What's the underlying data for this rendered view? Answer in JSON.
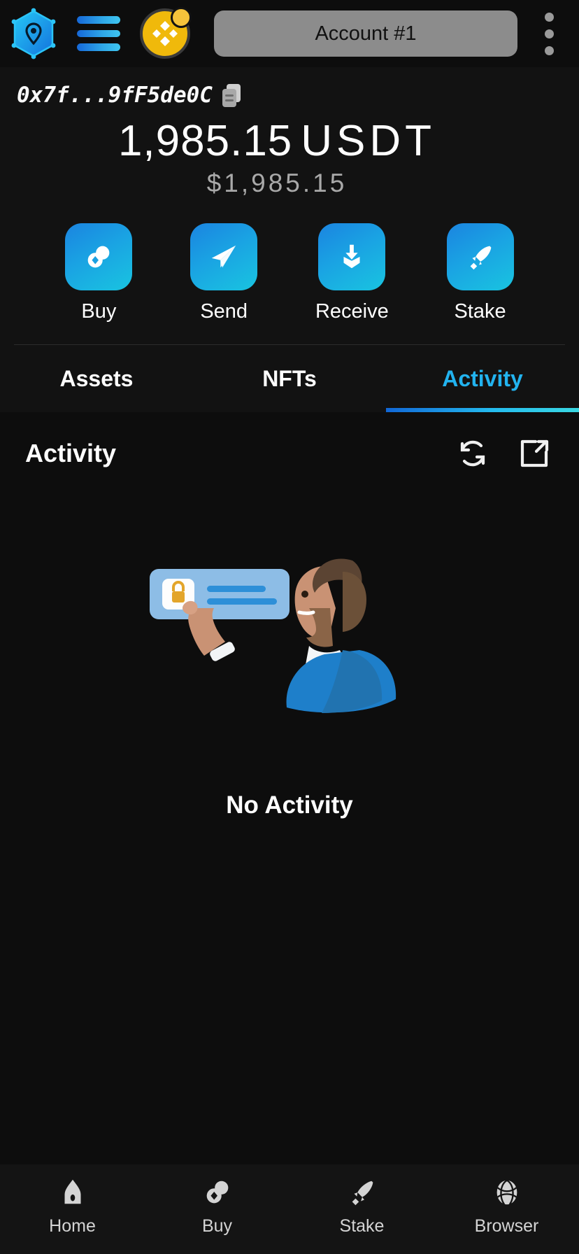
{
  "topbar": {
    "logo_icon": "vault-hexagon-logo-icon",
    "menu_icon": "hamburger-menu-icon",
    "network_icon": "bnb-network-icon",
    "account_label": "Account #1",
    "options_icon": "kebab-menu-icon"
  },
  "account": {
    "address": "0x7f...9fF5de0C",
    "copy_icon": "copy-icon",
    "balance": "1,985.15",
    "balance_unit": "USDT",
    "fiat_balance": "$1,985.15"
  },
  "actions": [
    {
      "label": "Buy",
      "icon": "buy-coins-icon"
    },
    {
      "label": "Send",
      "icon": "send-paper-plane-icon"
    },
    {
      "label": "Receive",
      "icon": "receive-download-icon"
    },
    {
      "label": "Stake",
      "icon": "stake-rocket-icon"
    }
  ],
  "tabs": [
    {
      "label": "Assets",
      "active": false
    },
    {
      "label": "NFTs",
      "active": false
    },
    {
      "label": "Activity",
      "active": true
    }
  ],
  "activity": {
    "title": "Activity",
    "refresh_icon": "refresh-icon",
    "external_icon": "external-link-icon",
    "empty_illustration": "man-pointing-at-secure-login-card-illustration",
    "empty_text": "No Activity"
  },
  "bottom_nav": [
    {
      "label": "Home",
      "icon": "home-icon"
    },
    {
      "label": "Buy",
      "icon": "buy-coins-icon"
    },
    {
      "label": "Stake",
      "icon": "stake-rocket-icon"
    },
    {
      "label": "Browser",
      "icon": "browser-globe-icon"
    }
  ],
  "colors": {
    "accent": "#22b3ef",
    "accent_gradient_start": "#1167d6",
    "accent_gradient_end": "#3ad8e2",
    "background": "#121212",
    "panel_background": "#0d0d0d",
    "network_yellow": "#f0b90b"
  }
}
